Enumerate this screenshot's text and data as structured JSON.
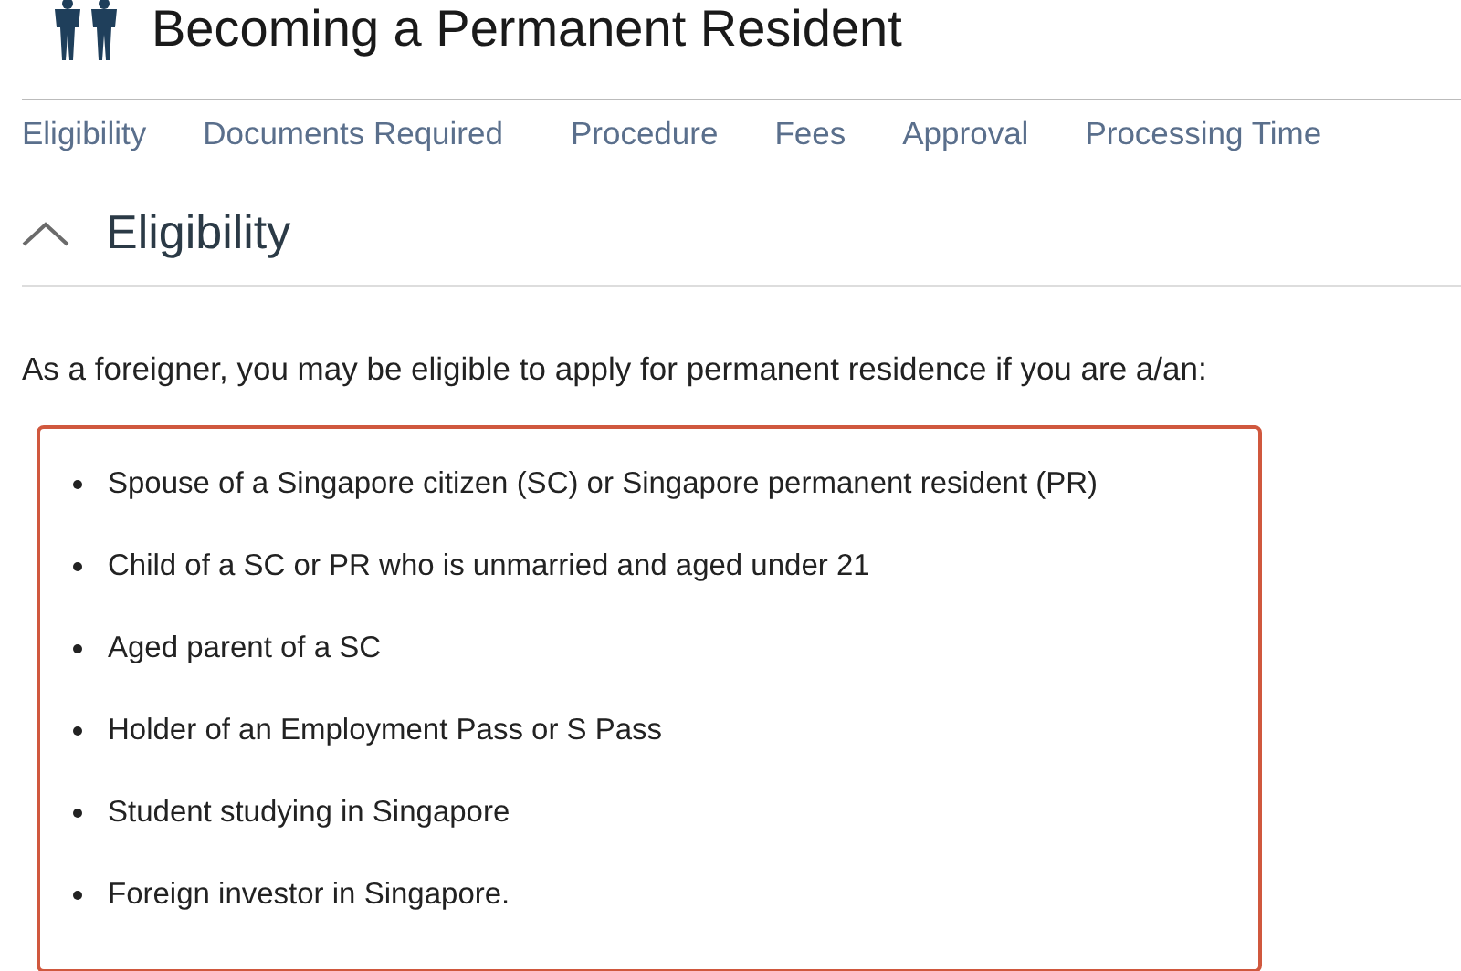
{
  "header": {
    "title": "Becoming a Permanent Resident"
  },
  "nav": {
    "links": [
      "Eligibility",
      "Documents Required",
      "Procedure",
      "Fees",
      "Approval",
      "Processing Time"
    ]
  },
  "section": {
    "title": "Eligibility",
    "expanded": true,
    "intro": "As a foreigner, you may be eligible to apply for permanent residence if you are a/an:",
    "items": [
      "Spouse of a Singapore citizen (SC) or Singapore permanent resident (PR)",
      "Child of a SC or PR who is unmarried and aged under 21",
      "Aged parent of a SC",
      "Holder of an Employment Pass or S Pass",
      "Student studying in Singapore",
      "Foreign investor in Singapore."
    ]
  }
}
